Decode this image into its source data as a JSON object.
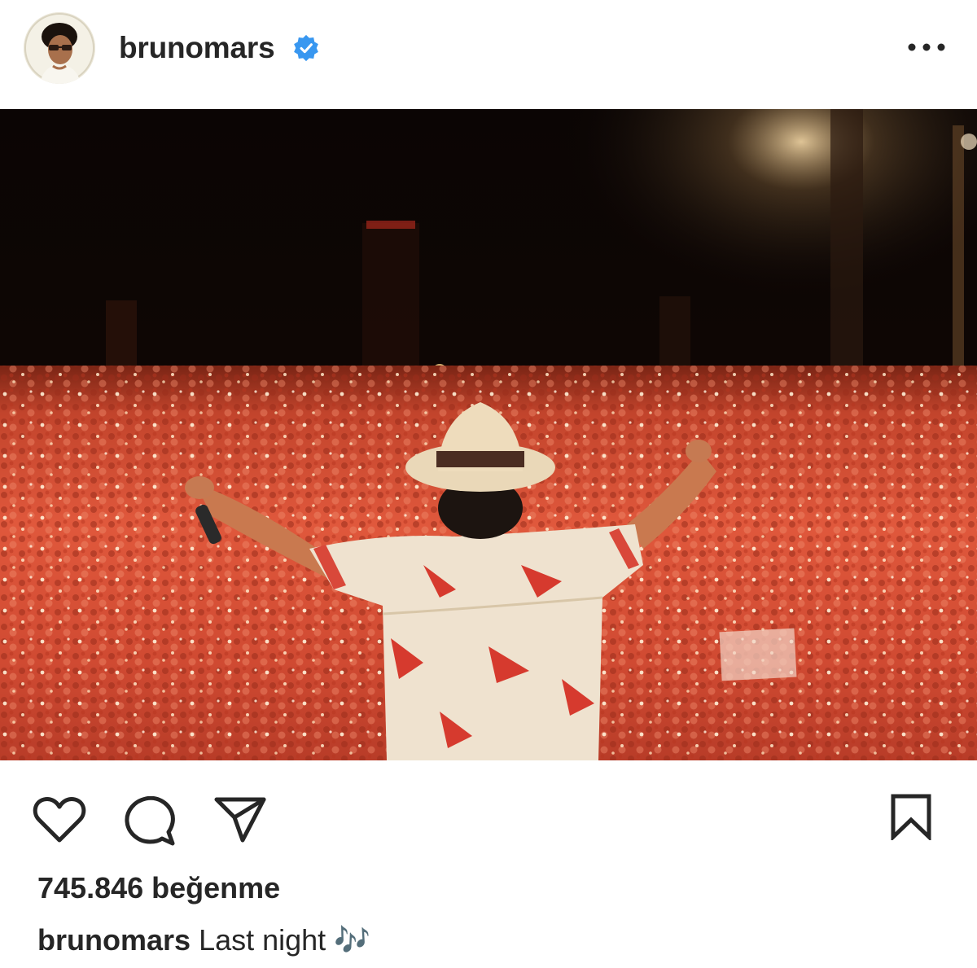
{
  "post": {
    "username": "brunomars",
    "verified_icon": "verified-badge-icon",
    "more_icon": "more-options-icon",
    "likes": "745.846 beğenme",
    "caption_user": "brunomars",
    "caption_text": "Last night 🎶"
  },
  "actions": {
    "like_icon": "heart-icon",
    "comment_icon": "comment-icon",
    "share_icon": "send-icon",
    "save_icon": "bookmark-icon"
  },
  "photo": {
    "description_icon": "concert-photo",
    "accent_colors": {
      "crowd": "#e15a3c",
      "sky": "#0c0504",
      "verified": "#3897f0"
    }
  }
}
